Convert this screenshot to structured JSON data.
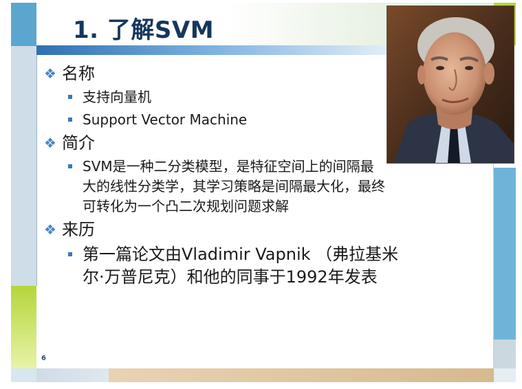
{
  "slide": {
    "title": "1. 了解SVM",
    "page_number": "6",
    "sections": [
      {
        "heading": "名称",
        "items": [
          "支持向量机",
          "Support Vector Machine"
        ]
      },
      {
        "heading": "简介",
        "items": [
          "SVM是一种二分类模型，是特征空间上的间隔最大的线性分类学，其学习策略是间隔最大化，最终可转化为一个凸二次规划问题求解"
        ]
      },
      {
        "heading": "来历",
        "items": [
          "第一篇论文由Vladimir Vapnik （弗拉基米尔·万普尼克）和他的同事于1992年发表"
        ]
      }
    ]
  },
  "colors": {
    "title": "#17365d",
    "bullet": "#3f76b9",
    "accent_green": "#b4d63a",
    "accent_blue": "#6fb4d8"
  },
  "icons": {
    "section_bullet": "diamond-bullet-icon",
    "item_bullet": "square-bullet-icon"
  }
}
